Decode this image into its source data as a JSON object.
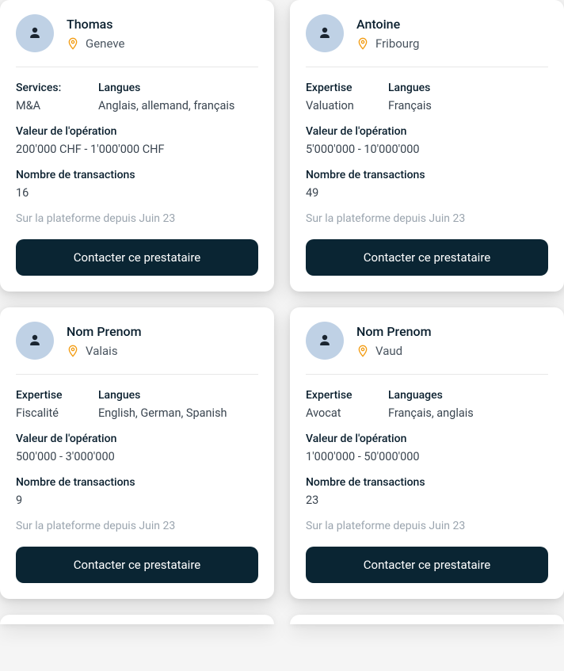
{
  "providers": [
    {
      "name": "Thomas",
      "location": "Geneve",
      "col1_label": "Services:",
      "col1_value": "M&A",
      "col2_label": "Langues",
      "col2_value": "Anglais, allemand, français",
      "deal_label": "Valeur de l'opération",
      "deal_value": "200'000 CHF - 1'000'000 CHF",
      "tx_label": "Nombre de transactions",
      "tx_value": "16",
      "since": "Sur la plateforme depuis Juin 23",
      "cta": "Contacter ce prestataire"
    },
    {
      "name": "Antoine",
      "location": "Fribourg",
      "col1_label": "Expertise",
      "col1_value": "Valuation",
      "col2_label": "Langues",
      "col2_value": "Français",
      "deal_label": "Valeur de l'opération",
      "deal_value": "5'000'000 - 10'000'000",
      "tx_label": "Nombre de transactions",
      "tx_value": "49",
      "since": "Sur la plateforme depuis Juin 23",
      "cta": "Contacter ce prestataire"
    },
    {
      "name": "Nom Prenom",
      "location": "Valais",
      "col1_label": "Expertise",
      "col1_value": "Fiscalité",
      "col2_label": "Langues",
      "col2_value": "English, German, Spanish",
      "deal_label": "Valeur de l'opération",
      "deal_value": "500'000 - 3'000'000",
      "tx_label": "Nombre de transactions",
      "tx_value": "9",
      "since": "Sur la plateforme depuis Juin 23",
      "cta": "Contacter ce prestataire"
    },
    {
      "name": "Nom Prenom",
      "location": "Vaud",
      "col1_label": "Expertise",
      "col1_value": "Avocat",
      "col2_label": "Languages",
      "col2_value": "Français, anglais",
      "deal_label": "Valeur de l'opération",
      "deal_value": "1'000'000 - 50'000'000",
      "tx_label": "Nombre de transactions",
      "tx_value": "23",
      "since": "Sur la plateforme depuis Juin 23",
      "cta": "Contacter ce prestataire"
    }
  ]
}
